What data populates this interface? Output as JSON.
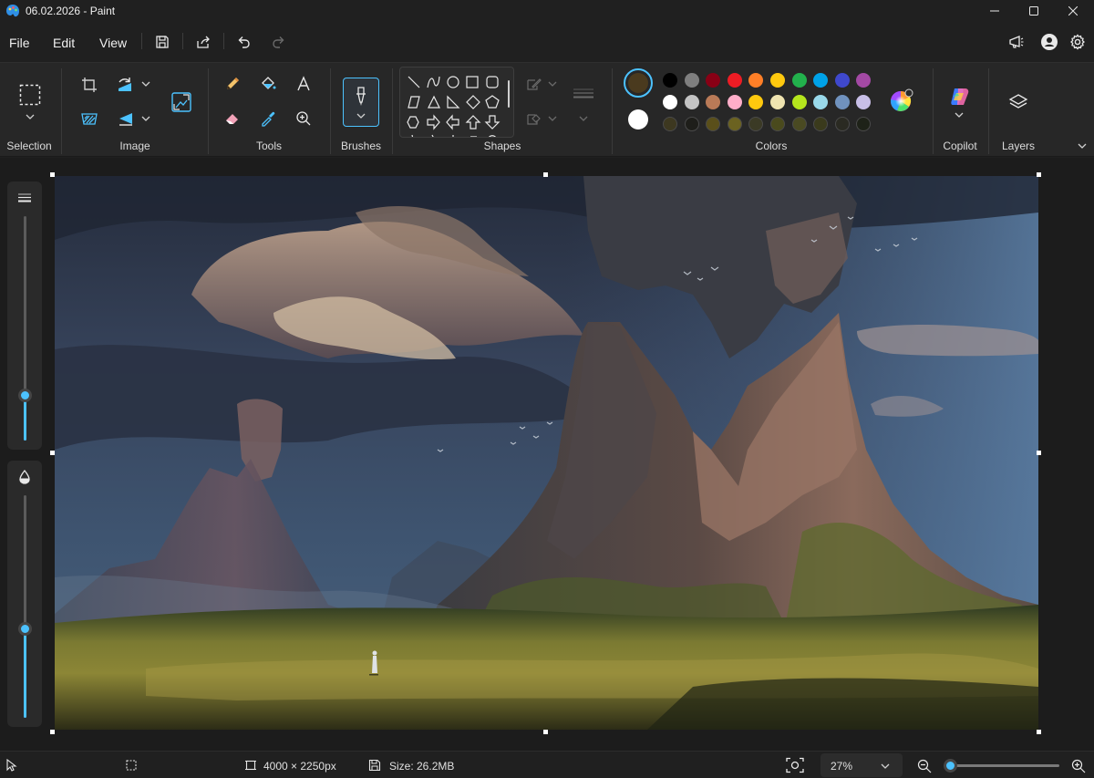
{
  "window": {
    "title": "06.02.2026 - Paint"
  },
  "menu": {
    "items": [
      "File",
      "Edit",
      "View"
    ]
  },
  "ribbon": {
    "groups": {
      "selection": "Selection",
      "image": "Image",
      "tools": "Tools",
      "brushes": "Brushes",
      "shapes": "Shapes",
      "colors": "Colors",
      "copilot": "Copilot",
      "layers": "Layers"
    },
    "colors": {
      "primary": "#4a3a1e",
      "secondary": "#ffffff",
      "palette_row1": [
        "#000000",
        "#7f7f7f",
        "#880015",
        "#ed1c24",
        "#ff7f27",
        "#ffc90e",
        "#22b14c",
        "#00a2e8",
        "#3f48cc",
        "#a349a4"
      ],
      "palette_row2": [
        "#ffffff",
        "#c3c3c3",
        "#b97a57",
        "#ffaec9",
        "#ffc90e",
        "#efe4b0",
        "#b5e61d",
        "#99d9ea",
        "#7092be",
        "#c8bfe7"
      ],
      "custom_row": [
        "#3d3820",
        "#1e1e1a",
        "#5a4f1a",
        "#6b6220",
        "#3b3a25",
        "#4a4a1d",
        "#4a4a22",
        "#3a3a1c",
        "#2a2a22",
        "#1e2218"
      ]
    }
  },
  "status": {
    "dimensions": "4000 × 2250px",
    "size": "Size: 26.2MB",
    "zoom": "27%",
    "zoom_slider_value": 0.04
  },
  "side_sliders": {
    "size_value": 0.2,
    "opacity_value": 0.4
  }
}
